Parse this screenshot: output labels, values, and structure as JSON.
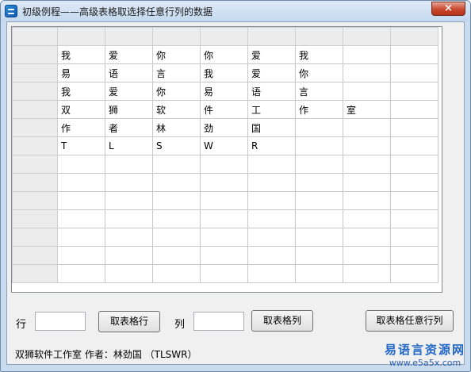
{
  "window": {
    "title": "初级例程——高级表格取选择任意行列的数据",
    "close_glyph": "×"
  },
  "grid": {
    "columns": 8,
    "rows": [
      [
        "我",
        "爱",
        "你",
        "你",
        "爱",
        "我",
        "",
        ""
      ],
      [
        "易",
        "语",
        "言",
        "我",
        "爱",
        "你",
        "",
        ""
      ],
      [
        "我",
        "爱",
        "你",
        "易",
        "语",
        "言",
        "",
        ""
      ],
      [
        "双",
        "狮",
        "软",
        "件",
        "工",
        "作",
        "室",
        ""
      ],
      [
        "作",
        "者",
        "林",
        "劲",
        "国",
        "",
        "",
        ""
      ],
      [
        "T",
        "L",
        "S",
        "W",
        "R",
        "",
        "",
        ""
      ],
      [
        "",
        "",
        "",
        "",
        "",
        "",
        "",
        ""
      ],
      [
        "",
        "",
        "",
        "",
        "",
        "",
        "",
        ""
      ],
      [
        "",
        "",
        "",
        "",
        "",
        "",
        "",
        ""
      ],
      [
        "",
        "",
        "",
        "",
        "",
        "",
        "",
        ""
      ],
      [
        "",
        "",
        "",
        "",
        "",
        "",
        "",
        ""
      ],
      [
        "",
        "",
        "",
        "",
        "",
        "",
        "",
        ""
      ],
      [
        "",
        "",
        "",
        "",
        "",
        "",
        "",
        ""
      ]
    ]
  },
  "controls": {
    "row_label": "行",
    "row_value": "",
    "get_row_button": "取表格行",
    "col_label": "列",
    "col_value": "",
    "get_col_button": "取表格列",
    "get_any_button": "取表格任意行列"
  },
  "footer": {
    "credit": "双狮软件工作室 作者：林劲国 （TLSWR）"
  },
  "watermark": {
    "title": "易语言资源网",
    "url": "www.e5a5x.com"
  }
}
